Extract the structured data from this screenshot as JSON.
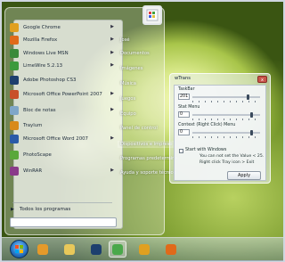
{
  "start_menu": {
    "programs": [
      {
        "label": "Google Chrome",
        "icon": "chrome-icon",
        "color": "#e0a020",
        "has_submenu": true
      },
      {
        "label": "Mozilla Firefox",
        "icon": "firefox-icon",
        "color": "#e06a1a",
        "has_submenu": true
      },
      {
        "label": "Windows Live MSN",
        "icon": "msn-icon",
        "color": "#3a8a3a",
        "has_submenu": true
      },
      {
        "label": "LimeWire 5.2.13",
        "icon": "limewire-icon",
        "color": "#3c9a3c",
        "has_submenu": true
      },
      {
        "label": "Adobe Photoshop CS3",
        "icon": "photoshop-icon",
        "color": "#1d3f6e",
        "has_submenu": false
      },
      {
        "label": "Microsoft Office PowerPoint 2007",
        "icon": "powerpoint-icon",
        "color": "#c8502a",
        "has_submenu": true
      },
      {
        "label": "Bloc de notas",
        "icon": "notepad-icon",
        "color": "#7fa6c8",
        "has_submenu": true
      },
      {
        "label": "Traylum",
        "icon": "traylum-icon",
        "color": "#d88a1a",
        "has_submenu": false
      },
      {
        "label": "Microsoft Office Word 2007",
        "icon": "word-icon",
        "color": "#2a5aa8",
        "has_submenu": true
      },
      {
        "label": "PhotoScape",
        "icon": "photoscape-icon",
        "color": "#5aa83a",
        "has_submenu": false
      },
      {
        "label": "WinRAR",
        "icon": "winrar-icon",
        "color": "#8a3a8a",
        "has_submenu": true
      }
    ],
    "all_programs_label": "Todos los programas",
    "right_items": [
      {
        "label": "José"
      },
      {
        "label": "Documentos"
      },
      {
        "label": "Imágenes"
      },
      {
        "label": "Música"
      },
      {
        "label": "Juegos"
      },
      {
        "label": "Equipo"
      },
      {
        "label": "Panel de control"
      },
      {
        "label": "Dispositivos e impreso"
      },
      {
        "label": "Programas predetermina"
      },
      {
        "label": "Ayuda y soporte técnico"
      }
    ]
  },
  "dialog": {
    "title": "wTrans",
    "close_label": "x",
    "taskbar": {
      "label": "TaskBar",
      "value": "201",
      "level": 0.82
    },
    "start_menu": {
      "label": "Stat Menu",
      "value": "0",
      "level": 0.88
    },
    "context_menu": {
      "label": "Context (Right Click) Menu",
      "value": "0",
      "level": 0.88
    },
    "start_with_windows_label": "Start with Windows",
    "note_line1": "You can not set the Value < 25.",
    "note_line2": "Right click Tray icon > Exit",
    "apply_label": "Apply"
  },
  "taskbar": {
    "items": [
      {
        "icon": "media-player-icon",
        "color": "#e59a2a",
        "active": false
      },
      {
        "icon": "file-explorer-icon",
        "color": "#e8c85a",
        "active": false
      },
      {
        "icon": "photoshop-icon",
        "color": "#1d3f6e",
        "active": false
      },
      {
        "icon": "wtrans-icon",
        "color": "#4aa84a",
        "active": true
      },
      {
        "icon": "chrome-icon",
        "color": "#e0a020",
        "active": false
      },
      {
        "icon": "firefox-icon",
        "color": "#e06a1a",
        "active": false
      }
    ]
  }
}
